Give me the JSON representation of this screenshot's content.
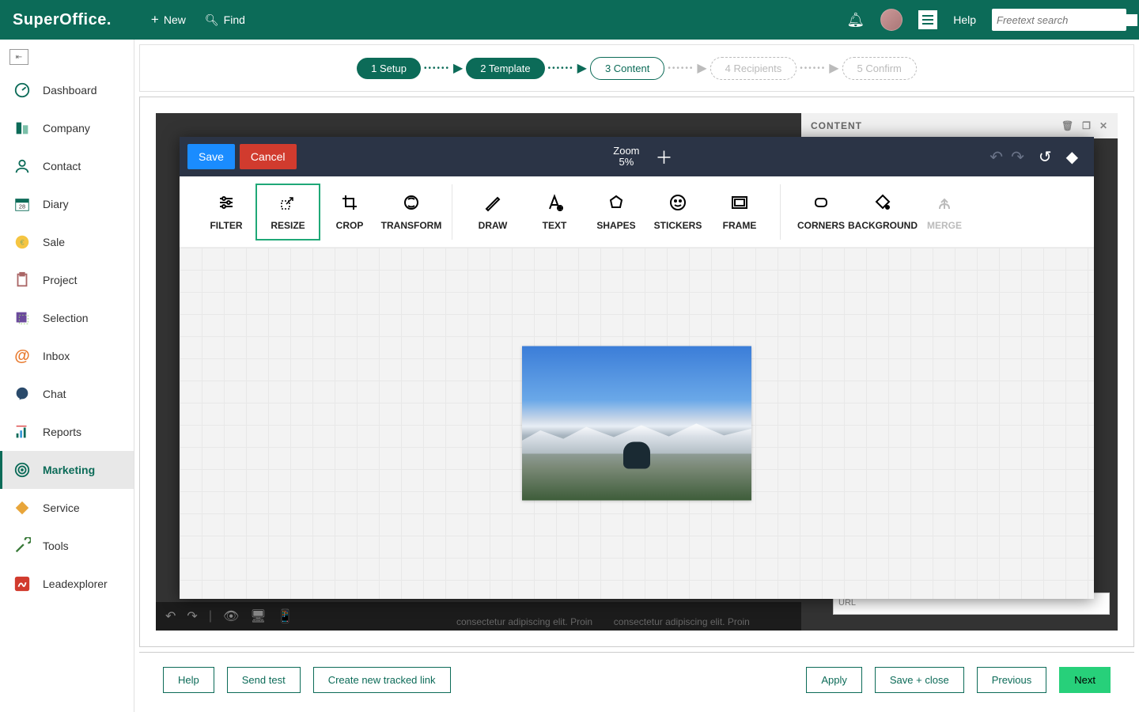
{
  "header": {
    "brand": "SuperOffice.",
    "new": "New",
    "find": "Find",
    "help": "Help",
    "search_placeholder": "Freetext search"
  },
  "sidebar": {
    "items": [
      {
        "label": "Dashboard"
      },
      {
        "label": "Company"
      },
      {
        "label": "Contact"
      },
      {
        "label": "Diary"
      },
      {
        "label": "Sale"
      },
      {
        "label": "Project"
      },
      {
        "label": "Selection"
      },
      {
        "label": "Inbox"
      },
      {
        "label": "Chat"
      },
      {
        "label": "Reports"
      },
      {
        "label": "Marketing"
      },
      {
        "label": "Service"
      },
      {
        "label": "Tools"
      },
      {
        "label": "Leadexplorer"
      }
    ]
  },
  "stepper": {
    "s1": "1 Setup",
    "s2": "2 Template",
    "s3": "3 Content",
    "s4": "4 Recipients",
    "s5": "5 Confirm"
  },
  "panel": {
    "title": "CONTENT",
    "url_label": "URL"
  },
  "editor": {
    "save": "Save",
    "cancel": "Cancel",
    "zoom_label": "Zoom",
    "zoom_value": "5%",
    "tools": {
      "filter": "FILTER",
      "resize": "RESIZE",
      "crop": "CROP",
      "transform": "TRANSFORM",
      "draw": "DRAW",
      "text": "TEXT",
      "shapes": "SHAPES",
      "stickers": "STICKERS",
      "frame": "FRAME",
      "corners": "CORNERS",
      "background": "BACKGROUND",
      "merge": "MERGE"
    }
  },
  "lorem": "consectetur adipiscing elit. Proin",
  "footer": {
    "help": "Help",
    "send_test": "Send test",
    "tracked": "Create new tracked link",
    "apply": "Apply",
    "save_close": "Save + close",
    "previous": "Previous",
    "next": "Next"
  }
}
